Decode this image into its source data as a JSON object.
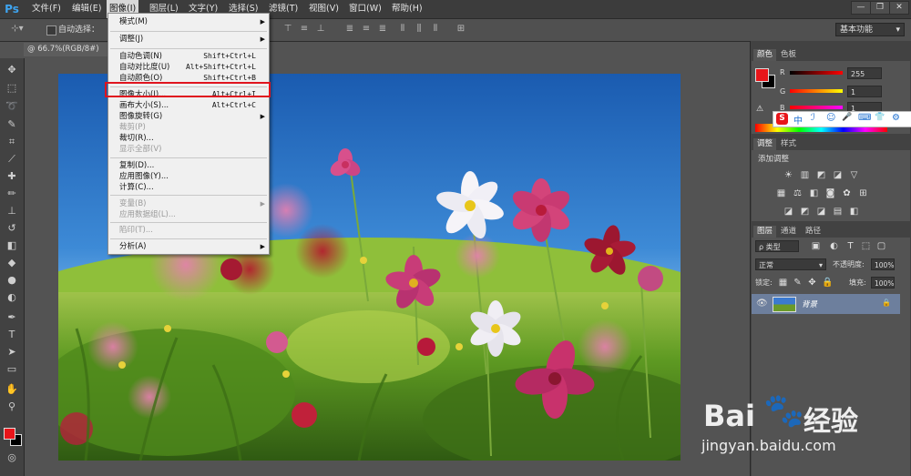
{
  "app": {
    "logo": "Ps",
    "window_controls": [
      "—",
      "❐",
      "✕"
    ]
  },
  "menubar": [
    {
      "label": "文件(F)"
    },
    {
      "label": "编辑(E)"
    },
    {
      "label": "图像(I)"
    },
    {
      "label": "图层(L)"
    },
    {
      "label": "文字(Y)"
    },
    {
      "label": "选择(S)"
    },
    {
      "label": "滤镜(T)"
    },
    {
      "label": "视图(V)"
    },
    {
      "label": "窗口(W)"
    },
    {
      "label": "帮助(H)"
    }
  ],
  "options_bar": {
    "auto_select_label": "自动选择：",
    "workspace": "基本功能"
  },
  "document_tab": "@ 66.7%(RGB/8#)",
  "image_menu": [
    {
      "label": "模式(M)",
      "sub": "▶",
      "shortcut": ""
    },
    {
      "label": "调整(J)",
      "sub": "▶",
      "shortcut": ""
    },
    {
      "label": "自动色调(N)",
      "shortcut": "Shift+Ctrl+L"
    },
    {
      "label": "自动对比度(U)",
      "shortcut": "Alt+Shift+Ctrl+L"
    },
    {
      "label": "自动颜色(O)",
      "shortcut": "Shift+Ctrl+B"
    },
    {
      "label": "图像大小(I)...",
      "shortcut": "Alt+Ctrl+I"
    },
    {
      "label": "画布大小(S)...",
      "shortcut": "Alt+Ctrl+C"
    },
    {
      "label": "图像旋转(G)",
      "sub": "▶",
      "shortcut": ""
    },
    {
      "label": "裁剪(P)",
      "shortcut": "",
      "disabled": true
    },
    {
      "label": "裁切(R)...",
      "shortcut": ""
    },
    {
      "label": "显示全部(V)",
      "shortcut": "",
      "disabled": true
    },
    {
      "label": "复制(D)...",
      "shortcut": ""
    },
    {
      "label": "应用图像(Y)...",
      "shortcut": ""
    },
    {
      "label": "计算(C)...",
      "shortcut": ""
    },
    {
      "label": "变量(B)",
      "sub": "▶",
      "shortcut": "",
      "disabled": true
    },
    {
      "label": "应用数据组(L)...",
      "shortcut": "",
      "disabled": true
    },
    {
      "label": "陷印(T)...",
      "shortcut": "",
      "disabled": true
    },
    {
      "label": "分析(A)",
      "sub": "▶",
      "shortcut": ""
    }
  ],
  "color_panel": {
    "tabs": [
      "颜色",
      "色板"
    ],
    "channels": [
      {
        "label": "R",
        "value": "255"
      },
      {
        "label": "G",
        "value": "1"
      },
      {
        "label": "B",
        "value": "1"
      }
    ],
    "foreground": "#e8151a",
    "background": "#000000"
  },
  "adjust_panel": {
    "tabs": [
      "调整",
      "样式"
    ],
    "title": "添加调整"
  },
  "layers_panel": {
    "tabs": [
      "图层",
      "通道",
      "路径"
    ],
    "filter_label": "ρ 类型",
    "blend_mode": "正常",
    "opacity_label": "不透明度:",
    "opacity": "100%",
    "lock_label": "锁定:",
    "fill_label": "填充:",
    "fill": "100%",
    "layer_name": "背景"
  },
  "ime_bar": {
    "logo": "S",
    "items": [
      "中",
      "ℐ",
      "☺",
      "🎤",
      "⌨",
      "👕",
      "⚙"
    ]
  },
  "watermark": {
    "brand": "Bai",
    "brand_tail": "经验",
    "url": "jingyan.baidu.com"
  }
}
